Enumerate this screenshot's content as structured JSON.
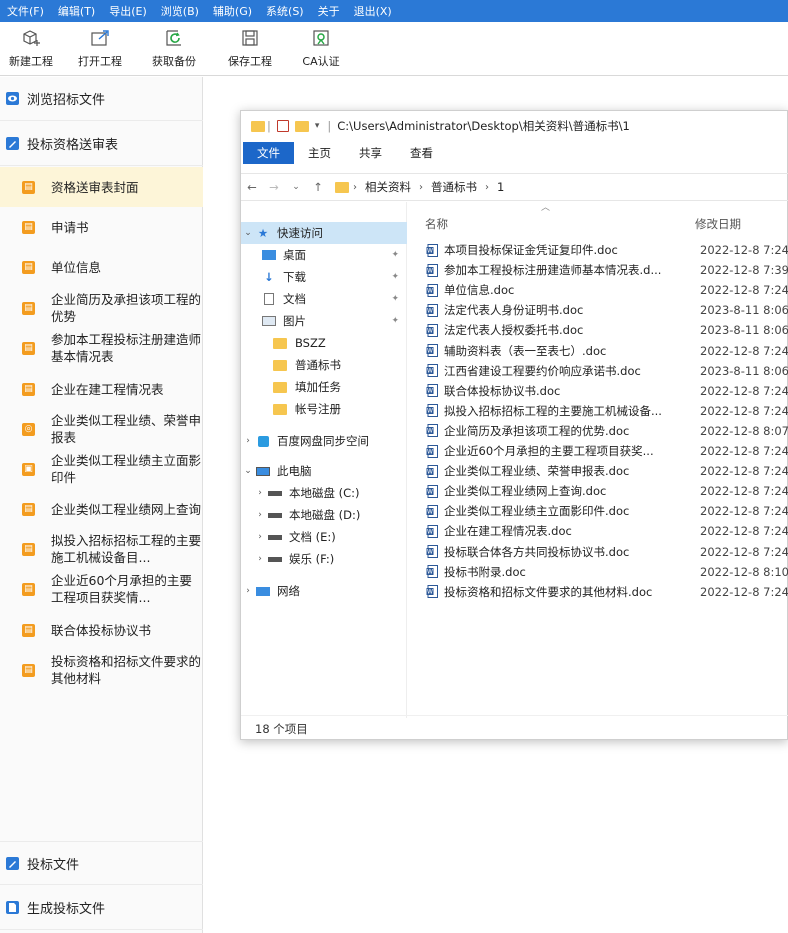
{
  "menu": [
    "文件(F)",
    "编辑(T)",
    "导出(E)",
    "浏览(B)",
    "辅助(G)",
    "系统(S)",
    "关于",
    "退出(X)"
  ],
  "toolbar": {
    "new_project": "新建工程",
    "open_project": "打开工程",
    "get_backup": "获取备份",
    "save_project": "保存工程",
    "ca_auth": "CA认证"
  },
  "sidebar": {
    "browse_tender": "浏览招标文件",
    "qualification": "投标资格送审表",
    "items": [
      "资格送审表封面",
      "申请书",
      "单位信息",
      "企业简历及承担该项工程的优势",
      "参加本工程投标注册建造师基本情况表",
      "企业在建工程情况表",
      "企业类似工程业绩、荣誉申报表",
      "企业类似工程业绩主立面影印件",
      "企业类似工程业绩网上查询",
      "拟投入招标招标工程的主要施工机械设备目...",
      "企业近60个月承担的主要工程项目获奖情...",
      "联合体投标协议书",
      "投标资格和招标文件要求的其他材料"
    ],
    "bid_file": "投标文件",
    "generate_bid": "生成投标文件"
  },
  "explorer": {
    "title_path": "C:\\Users\\Administrator\\Desktop\\相关资料\\普通标书\\1",
    "ribbon": {
      "file": "文件",
      "home": "主页",
      "share": "共享",
      "view": "查看"
    },
    "breadcrumb": [
      "相关资料",
      "普通标书",
      "1"
    ],
    "col_name": "名称",
    "col_date": "修改日期",
    "nav": {
      "quick_access": "快速访问",
      "desktop": "桌面",
      "downloads": "下载",
      "documents": "文档",
      "pictures": "图片",
      "f1": "BSZZ",
      "f2": "普通标书",
      "f3": "填加任务",
      "f4": "帐号注册",
      "baidu": "百度网盘同步空间",
      "this_pc": "此电脑",
      "c_drive": "本地磁盘 (C:)",
      "d_drive": "本地磁盘 (D:)",
      "e_drive": "文档 (E:)",
      "f_drive": "娱乐 (F:)",
      "network": "网络"
    },
    "files": [
      {
        "name": "本项目投标保证金凭证复印件.doc",
        "date": "2022-12-8 7:24"
      },
      {
        "name": "参加本工程投标注册建造师基本情况表.d...",
        "date": "2022-12-8 7:39"
      },
      {
        "name": "单位信息.doc",
        "date": "2022-12-8 7:24"
      },
      {
        "name": "法定代表人身份证明书.doc",
        "date": "2023-8-11 8:06"
      },
      {
        "name": "法定代表人授权委托书.doc",
        "date": "2023-8-11 8:06"
      },
      {
        "name": "辅助资料表（表一至表七）.doc",
        "date": "2022-12-8 7:24"
      },
      {
        "name": "江西省建设工程要约价响应承诺书.doc",
        "date": "2023-8-11 8:06"
      },
      {
        "name": "联合体投标协议书.doc",
        "date": "2022-12-8 7:24"
      },
      {
        "name": "拟投入招标招标工程的主要施工机械设备...",
        "date": "2022-12-8 7:24"
      },
      {
        "name": "企业简历及承担该项工程的优势.doc",
        "date": "2022-12-8 8:07"
      },
      {
        "name": "企业近60个月承担的主要工程项目获奖...",
        "date": "2022-12-8 7:24"
      },
      {
        "name": "企业类似工程业绩、荣誉申报表.doc",
        "date": "2022-12-8 7:24"
      },
      {
        "name": "企业类似工程业绩网上查询.doc",
        "date": "2022-12-8 7:24"
      },
      {
        "name": "企业类似工程业绩主立面影印件.doc",
        "date": "2022-12-8 7:24"
      },
      {
        "name": "企业在建工程情况表.doc",
        "date": "2022-12-8 7:24"
      },
      {
        "name": "投标联合体各方共同投标协议书.doc",
        "date": "2022-12-8 7:24"
      },
      {
        "name": "投标书附录.doc",
        "date": "2022-12-8 8:10"
      },
      {
        "name": "投标资格和招标文件要求的其他材料.doc",
        "date": "2022-12-8 7:24"
      }
    ],
    "status": "18 个项目"
  },
  "colors": {
    "menubar": "#2b79d6",
    "accent_orange": "#f39c1f",
    "active_row": "#fdf5d8",
    "ribbon_file": "#1c67c9"
  }
}
